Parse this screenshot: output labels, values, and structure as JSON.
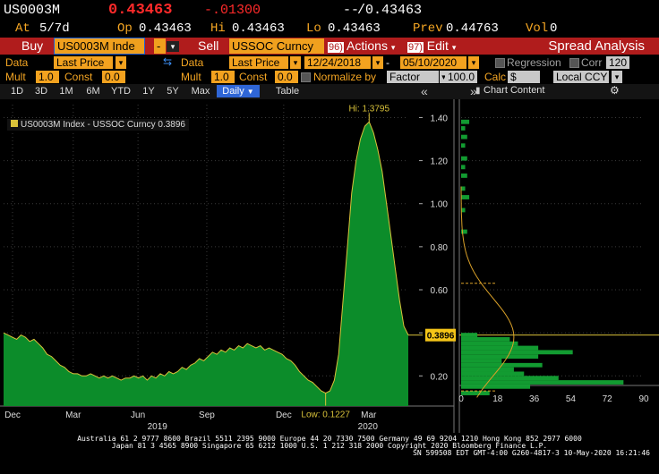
{
  "header": {
    "ticker": "US0003M",
    "last": "0.43463",
    "change": "-.01300",
    "range_label": "--",
    "range_value": "/0.43463",
    "at_label": "At",
    "at_value": "5/7d",
    "op_label": "Op",
    "op_value": "0.43463",
    "hi_label": "Hi",
    "hi_value": "0.43463",
    "lo_label": "Lo",
    "lo_value": "0.43463",
    "prev_label": "Prev",
    "prev_value": "0.44763",
    "vol_label": "Vol",
    "vol_value": "0"
  },
  "toolbar": {
    "buy_label": "Buy",
    "security1": "US0003M Inde",
    "dash": "-",
    "sell_label": "Sell",
    "security2": "USSOC Curncy",
    "actions_num": "96)",
    "actions_label": "Actions",
    "edit_num": "97)",
    "edit_label": "Edit",
    "title": "Spread Analysis"
  },
  "settings": {
    "data1_label": "Data",
    "data1_value": "Last Price",
    "data2_label": "Data",
    "data2_value": "Last Price",
    "start_date": "12/24/2018",
    "date_sep": "-",
    "end_date": "05/10/2020",
    "regression_label": "Regression",
    "corr_label": "Corr",
    "corr_value": "120",
    "mult1_label": "Mult",
    "mult1_value": "1.0",
    "const1_label": "Const",
    "const1_value": "0.0",
    "mult2_label": "Mult",
    "mult2_value": "1.0",
    "const2_label": "Const",
    "const2_value": "0.0",
    "normalize_label": "Normalize by",
    "normalize_value": "Factor",
    "factor_value": "100.0",
    "calc_label": "Calc",
    "calc_value": "$",
    "ccy_value": "Local CCY"
  },
  "tabs": {
    "items": [
      "1D",
      "3D",
      "1M",
      "6M",
      "YTD",
      "1Y",
      "5Y",
      "Max"
    ],
    "daily": "Daily",
    "table": "Table",
    "chart_content": "Chart Content"
  },
  "chart_data": {
    "type": "area",
    "legend": "US0003M Index - USSOC Curncy 0.3896",
    "hi_label": "Hi: 1.3795",
    "low_label": "Low: 0.1227",
    "current_label": "0.3896",
    "yticks": [
      "1.40",
      "1.20",
      "1.00",
      "0.80",
      "0.60",
      "0.40",
      "0.20"
    ],
    "ytick_values": [
      1.4,
      1.2,
      1.0,
      0.8,
      0.6,
      0.4,
      0.2
    ],
    "ylim": [
      0.06,
      1.46
    ],
    "xticks": [
      "Dec",
      "Mar",
      "Jun",
      "Sep",
      "Dec",
      "Mar"
    ],
    "xticks_frac": [
      0.0,
      0.15,
      0.31,
      0.48,
      0.67,
      0.88
    ],
    "years": [
      "2019",
      "2020"
    ],
    "years_frac": [
      0.38,
      0.9
    ],
    "values": [
      0.4,
      0.39,
      0.38,
      0.37,
      0.39,
      0.38,
      0.36,
      0.37,
      0.35,
      0.33,
      0.3,
      0.29,
      0.27,
      0.25,
      0.24,
      0.22,
      0.21,
      0.21,
      0.2,
      0.2,
      0.21,
      0.2,
      0.19,
      0.2,
      0.19,
      0.2,
      0.19,
      0.18,
      0.19,
      0.19,
      0.2,
      0.19,
      0.2,
      0.18,
      0.2,
      0.19,
      0.21,
      0.2,
      0.22,
      0.21,
      0.22,
      0.24,
      0.23,
      0.25,
      0.26,
      0.28,
      0.27,
      0.29,
      0.31,
      0.3,
      0.32,
      0.31,
      0.33,
      0.32,
      0.34,
      0.33,
      0.35,
      0.34,
      0.33,
      0.34,
      0.32,
      0.33,
      0.32,
      0.31,
      0.3,
      0.28,
      0.27,
      0.25,
      0.22,
      0.2,
      0.18,
      0.17,
      0.15,
      0.13,
      0.12,
      0.13,
      0.18,
      0.3,
      0.55,
      0.8,
      1.05,
      1.2,
      1.3,
      1.36,
      1.38,
      1.33,
      1.25,
      1.15,
      1.0,
      0.85,
      0.7,
      0.55,
      0.43,
      0.39
    ],
    "hist_xticks": [
      "0",
      "18",
      "36",
      "54",
      "72",
      "90"
    ],
    "hist_xlim": [
      0,
      90
    ],
    "hist_bins": [
      {
        "y": 0.12,
        "c": 14
      },
      {
        "y": 0.15,
        "c": 34
      },
      {
        "y": 0.17,
        "c": 80
      },
      {
        "y": 0.19,
        "c": 48
      },
      {
        "y": 0.21,
        "c": 31
      },
      {
        "y": 0.23,
        "c": 26
      },
      {
        "y": 0.25,
        "c": 40
      },
      {
        "y": 0.27,
        "c": 20
      },
      {
        "y": 0.29,
        "c": 38
      },
      {
        "y": 0.31,
        "c": 55
      },
      {
        "y": 0.33,
        "c": 38
      },
      {
        "y": 0.35,
        "c": 28
      },
      {
        "y": 0.37,
        "c": 24
      },
      {
        "y": 0.39,
        "c": 8
      },
      {
        "y": 0.87,
        "c": 3
      },
      {
        "y": 0.97,
        "c": 2
      },
      {
        "y": 1.03,
        "c": 4
      },
      {
        "y": 1.07,
        "c": 2
      },
      {
        "y": 1.13,
        "c": 3
      },
      {
        "y": 1.17,
        "c": 2
      },
      {
        "y": 1.21,
        "c": 3
      },
      {
        "y": 1.27,
        "c": 2
      },
      {
        "y": 1.31,
        "c": 3
      },
      {
        "y": 1.35,
        "c": 2
      },
      {
        "y": 1.38,
        "c": 4
      }
    ]
  },
  "footer": {
    "line1": "Australia 61 2 9777 8600 Brazil 5511 2395 9000 Europe 44 20 7330 7500 Germany 49 69 9204 1210 Hong Kong 852 2977 6000",
    "line2": "Japan 81 3 4565 8900         Singapore 65 6212 1000         U.S. 1 212 318 2000                 Copyright 2020 Bloomberg Finance L.P.",
    "line3": "SN 599508 EDT  GMT-4:00 G260-4817-3 10-May-2020 16:21:46"
  },
  "colors": {
    "orange": "#f5a623",
    "red_bar": "#b01c1c",
    "fill_green": "#0c8c2a",
    "line_yellow": "#d9c23a",
    "last_red": "#ff2a2a"
  }
}
